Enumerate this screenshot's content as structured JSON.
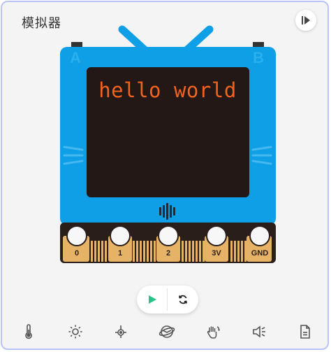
{
  "panel": {
    "title": "模拟器"
  },
  "device": {
    "screen_text": "hello world",
    "button_a": "A",
    "button_b": "B",
    "pins": [
      "0",
      "1",
      "2",
      "3V",
      "GND"
    ]
  },
  "controls": {
    "play_icon": "play-icon",
    "reset_icon": "refresh-icon"
  },
  "toolbar": {
    "icons": [
      "thermometer-icon",
      "brightness-icon",
      "compass-icon",
      "accelerometer-icon",
      "gesture-icon",
      "speaker-icon",
      "serial-log-icon"
    ]
  },
  "colors": {
    "device_blue": "#0e9fe6",
    "screen": "#231816",
    "text": "#f2631f",
    "pin_gold": "#e6b265",
    "play_green": "#2bc28a"
  }
}
